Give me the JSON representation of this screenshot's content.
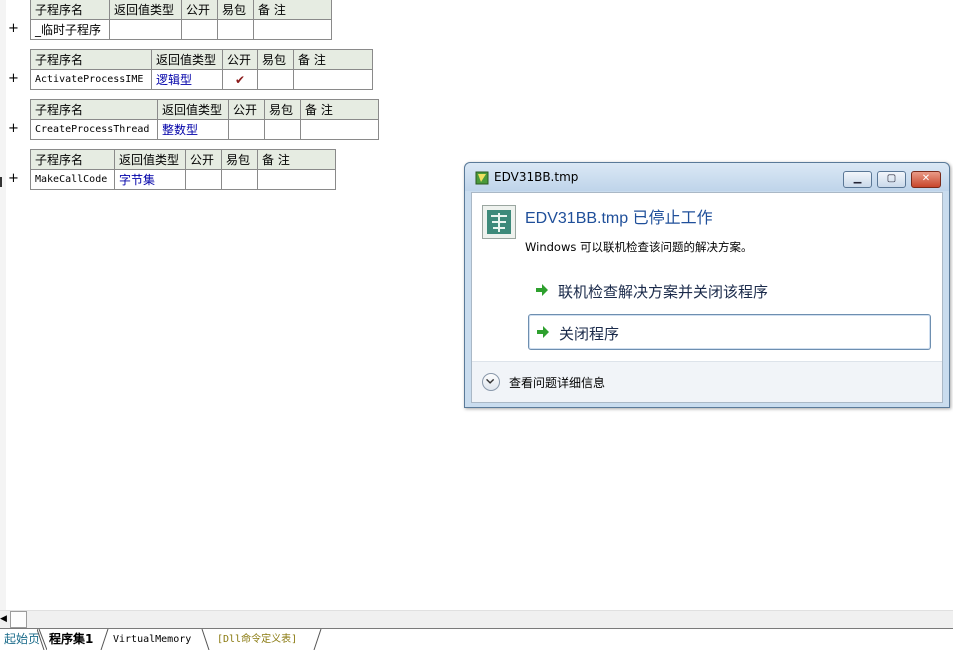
{
  "subroutine_tables": [
    {
      "headers": [
        "子程序名",
        "返回值类型",
        "公开",
        "易包",
        "备 注"
      ],
      "row": {
        "name": "_临时子程序",
        "return_type": "",
        "public": "",
        "easy_pkg": "",
        "note": ""
      }
    },
    {
      "headers": [
        "子程序名",
        "返回值类型",
        "公开",
        "易包",
        "备 注"
      ],
      "row": {
        "name": "ActivateProcessIME",
        "return_type": "逻辑型",
        "public": "✔",
        "easy_pkg": "",
        "note": ""
      }
    },
    {
      "headers": [
        "子程序名",
        "返回值类型",
        "公开",
        "易包",
        "备 注"
      ],
      "row": {
        "name": "CreateProcessThread",
        "return_type": "整数型",
        "public": "",
        "easy_pkg": "",
        "note": ""
      }
    },
    {
      "headers": [
        "子程序名",
        "返回值类型",
        "公开",
        "易包",
        "备 注"
      ],
      "row": {
        "name": "MakeCallCode",
        "return_type": "字节集",
        "public": "",
        "easy_pkg": "",
        "note": ""
      }
    }
  ],
  "expand_symbol": "+",
  "tabs": {
    "start": "起始页",
    "set1": "程序集1",
    "vm": "VirtualMemory",
    "dll": "[Dll命令定义表]"
  },
  "dialog": {
    "title": "EDV31BB.tmp",
    "heading": "EDV31BB.tmp 已停止工作",
    "description": "Windows 可以联机检查该问题的解决方案。",
    "option_check_online": "联机检查解决方案并关闭该程序",
    "option_close": "关闭程序",
    "details": "查看问题详细信息",
    "colors": {
      "heading": "#1f4f9a",
      "arrow": "#2ea02e",
      "close": "#c8462b"
    }
  }
}
